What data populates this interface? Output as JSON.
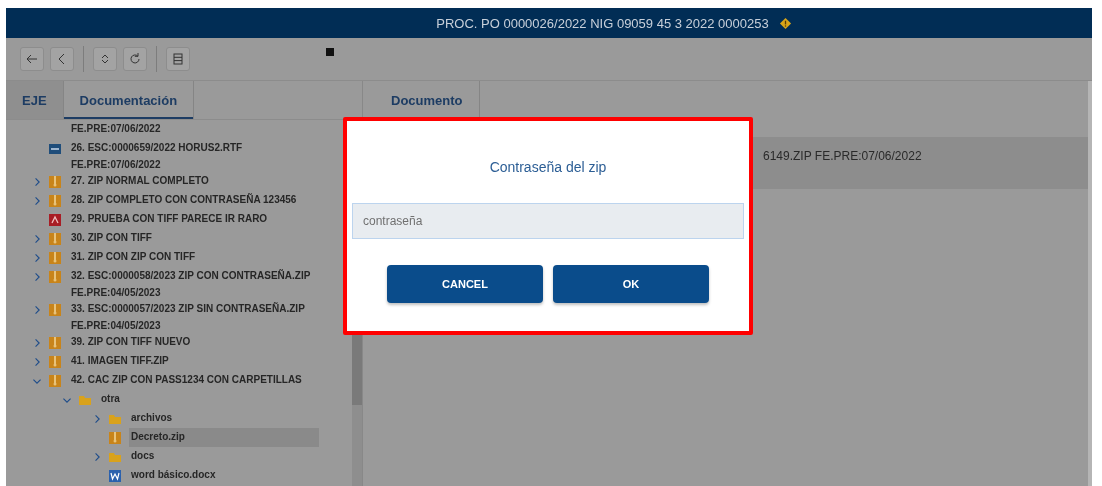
{
  "header": {
    "title": "PROC. PO 0000026/2022 NIG 09059 45 3 2022 0000253"
  },
  "left_tabs": [
    {
      "label": "EJE",
      "selected": false
    },
    {
      "label": "Documentación",
      "selected": true
    }
  ],
  "tree": [
    {
      "kind": "none",
      "label": "FE.PRE:07/06/2022",
      "selected": false
    },
    {
      "kind": "rtf",
      "label": "26. ESC:0000659/2022 HORUS2.RTF",
      "sub": "FE.PRE:07/06/2022",
      "selected": false
    },
    {
      "kind": "zip",
      "label": "27. ZIP NORMAL COMPLETO",
      "expanded": false,
      "selected": false
    },
    {
      "kind": "zip",
      "label": "28. ZIP COMPLETO CON CONTRASEÑA 123456",
      "expanded": false,
      "selected": false
    },
    {
      "kind": "pdf",
      "label": "29. PRUEBA CON TIFF PARECE IR RARO",
      "selected": false
    },
    {
      "kind": "zip",
      "label": "30. ZIP CON TIFF",
      "expanded": false,
      "selected": false
    },
    {
      "kind": "zip",
      "label": "31. ZIP CON ZIP CON TIFF",
      "expanded": false,
      "selected": false
    },
    {
      "kind": "zip",
      "label": "32. ESC:0000058/2023 ZIP CON CONTRASEÑA.ZIP",
      "sub": "FE.PRE:04/05/2023",
      "expanded": false,
      "selected": false
    },
    {
      "kind": "zip",
      "label": "33. ESC:0000057/2023 ZIP SIN CONTRASEÑA.ZIP",
      "sub": "FE.PRE:04/05/2023",
      "expanded": false,
      "selected": false
    },
    {
      "kind": "zip",
      "label": "39. ZIP CON TIFF NUEVO",
      "expanded": false,
      "selected": false
    },
    {
      "kind": "zip",
      "label": "41. IMAGEN TIFF.ZIP",
      "expanded": false,
      "selected": false
    },
    {
      "kind": "zip",
      "label": "42. CAC ZIP CON PASS1234 CON CARPETILLAS",
      "expanded": true,
      "selected": false,
      "children": [
        {
          "kind": "folder",
          "label": "otra",
          "expanded": true,
          "selected": false,
          "children": [
            {
              "kind": "folder",
              "label": "archivos",
              "expanded": false,
              "selected": false
            },
            {
              "kind": "zip",
              "label": "Decreto.zip",
              "selected": true
            },
            {
              "kind": "folder",
              "label": "docs",
              "expanded": false,
              "selected": false
            },
            {
              "kind": "word",
              "label": "word básico.docx",
              "selected": false
            }
          ]
        }
      ]
    }
  ],
  "right_tabs": [
    {
      "label": "Documento",
      "selected": true
    }
  ],
  "document_row": {
    "text": "6149.ZIP FE.PRE:07/06/2022"
  },
  "dialog": {
    "title": "Contraseña del zip",
    "placeholder": "contraseña",
    "buttons": [
      "CANCEL",
      "OK"
    ]
  }
}
